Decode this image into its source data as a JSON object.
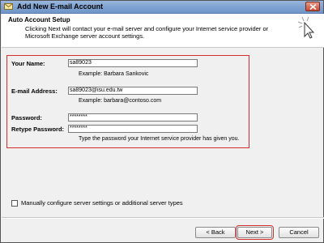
{
  "window": {
    "title": "Add New E-mail Account"
  },
  "header": {
    "title": "Auto Account Setup",
    "description": "Clicking Next will contact your e-mail server and configure your Internet service provider or Microsoft Exchange server account settings."
  },
  "form": {
    "name_label": "Your Name:",
    "name_value": "sa89023",
    "name_example": "Example: Barbara Sankovic",
    "email_label": "E-mail Address:",
    "email_value": "sa89023@isu.edu.tw",
    "email_example": "Example: barbara@contoso.com",
    "password_label": "Password:",
    "password_value": "********",
    "retype_label": "Retype Password:",
    "retype_value": "********",
    "password_hint": "Type the password your Internet service provider has given you."
  },
  "manual_config": {
    "label": "Manually configure server settings or additional server types",
    "checked": false
  },
  "buttons": {
    "back": "< Back",
    "next": "Next >",
    "cancel": "Cancel"
  },
  "colors": {
    "highlight": "#d32f2f",
    "titlebar": "#7fa3d2"
  }
}
